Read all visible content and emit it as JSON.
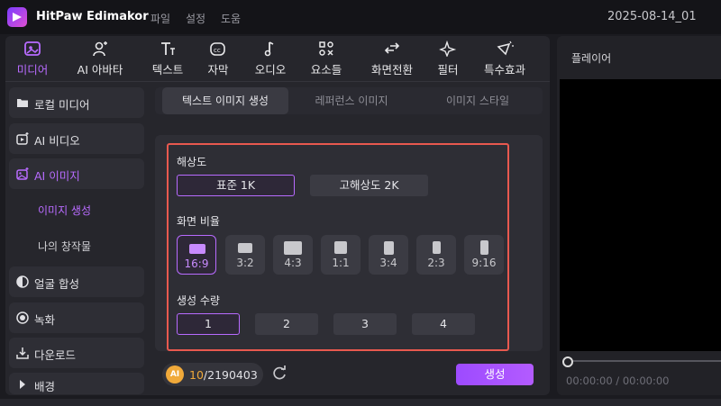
{
  "app": {
    "title": "HitPaw Edimakor",
    "project": "2025-08-14_01"
  },
  "menu": [
    "파일",
    "설정",
    "도움"
  ],
  "toolbar": [
    {
      "label": "미디어",
      "icon": "media-icon",
      "active": true
    },
    {
      "label": "AI 아바타",
      "icon": "avatar-icon",
      "active": false
    },
    {
      "label": "텍스트",
      "icon": "text-icon",
      "active": false
    },
    {
      "label": "자막",
      "icon": "caption-icon",
      "active": false
    },
    {
      "label": "오디오",
      "icon": "music-icon",
      "active": false
    },
    {
      "label": "요소들",
      "icon": "elements-icon",
      "active": false
    },
    {
      "label": "화면전환",
      "icon": "transition-icon",
      "active": false
    },
    {
      "label": "필터",
      "icon": "filter-icon",
      "active": false
    },
    {
      "label": "특수효과",
      "icon": "effects-icon",
      "active": false
    }
  ],
  "sidebar": {
    "items": [
      {
        "label": "로컬 미디어",
        "icon": "folder-icon"
      },
      {
        "label": "AI 비디오",
        "icon": "ai-video-icon"
      },
      {
        "label": "AI 이미지",
        "icon": "ai-image-icon",
        "active": true
      },
      {
        "label": "이미지 생성",
        "sub": true,
        "active": true
      },
      {
        "label": "나의 창작물",
        "sub": true
      },
      {
        "label": "얼굴 합성",
        "icon": "face-swap-icon"
      },
      {
        "label": "녹화",
        "icon": "record-icon"
      },
      {
        "label": "다운로드",
        "icon": "download-icon"
      },
      {
        "label": "배경",
        "icon": "caret-right-icon"
      }
    ]
  },
  "tabs": [
    {
      "label": "텍스트 이미지 생성",
      "active": true
    },
    {
      "label": "레퍼런스 이미지",
      "active": false
    },
    {
      "label": "이미지 스타일",
      "active": false
    }
  ],
  "settings": {
    "resolution": {
      "title": "해상도",
      "options": [
        "표준 1K",
        "고해상도 2K"
      ],
      "selected": 0
    },
    "aspect": {
      "title": "화면 비율",
      "options": [
        "16:9",
        "3:2",
        "4:3",
        "1:1",
        "3:4",
        "2:3",
        "9:16"
      ],
      "selected": 0
    },
    "count": {
      "title": "생성 수량",
      "options": [
        "1",
        "2",
        "3",
        "4"
      ],
      "selected": 0
    }
  },
  "bottom": {
    "ai_badge": "AI",
    "credits_used": "10",
    "credits_total": "/2190403",
    "generate": "생성"
  },
  "player": {
    "title": "플레이어",
    "time_current": "00:00:00",
    "time_separator": " / ",
    "time_total": "00:00:00"
  },
  "colors": {
    "accent": "#b86bff",
    "highlight_box": "#e8594f",
    "credit": "#f0a93a"
  }
}
